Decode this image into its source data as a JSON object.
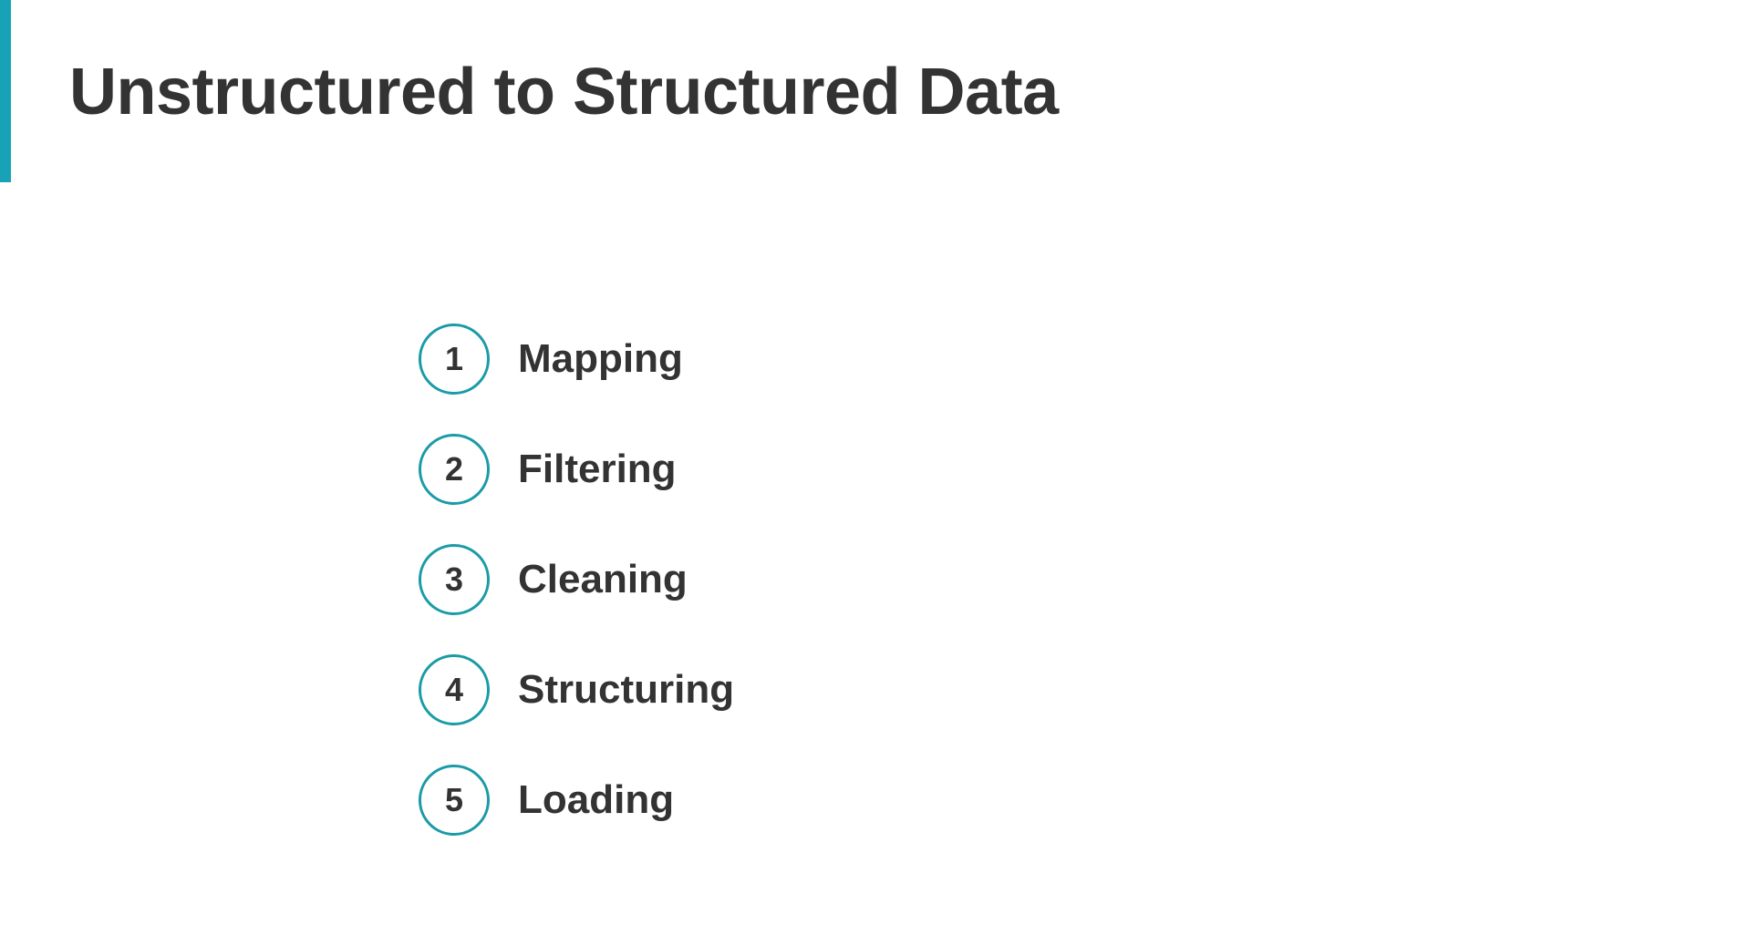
{
  "slide": {
    "title": "Unstructured to Structured Data",
    "accent_color": "#17a2b8",
    "circle_color": "#1a9ba6"
  },
  "steps": [
    {
      "number": "1",
      "label": "Mapping"
    },
    {
      "number": "2",
      "label": "Filtering"
    },
    {
      "number": "3",
      "label": "Cleaning"
    },
    {
      "number": "4",
      "label": "Structuring"
    },
    {
      "number": "5",
      "label": "Loading"
    }
  ]
}
